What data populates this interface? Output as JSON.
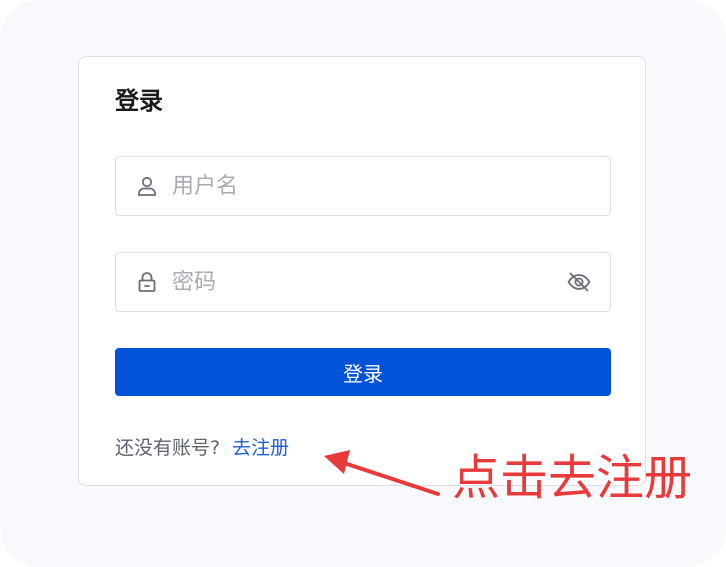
{
  "login_card": {
    "title": "登录",
    "username": {
      "placeholder": "用户名",
      "value": ""
    },
    "password": {
      "placeholder": "密码",
      "value": ""
    },
    "submit_label": "登录",
    "register_prompt": "还没有账号?",
    "register_link": "去注册"
  },
  "annotation": {
    "text": "点击去注册",
    "color": "#e83a3a"
  },
  "colors": {
    "primary": "#0052d9",
    "link": "#1f5fd1",
    "border": "#dcdfe6",
    "placeholder": "#a8abb2"
  },
  "icons": {
    "username": "user-icon",
    "password": "lock-icon",
    "visibility": "eye-off-icon",
    "annotation": "arrow-icon"
  }
}
